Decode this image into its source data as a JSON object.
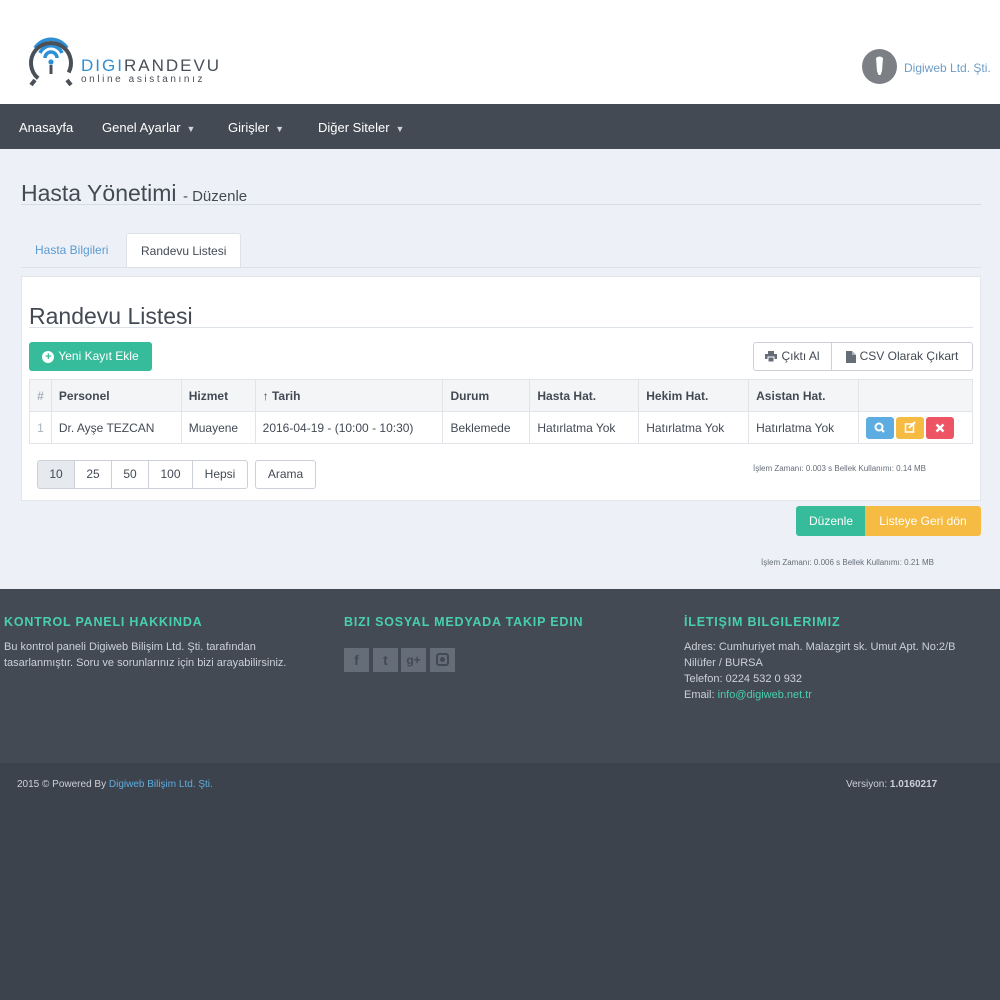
{
  "header": {
    "logo_text_accent": "DIGI",
    "logo_text_rest": "RANDEVU",
    "logo_subtitle": "online asistanınız",
    "user_name": "Digiweb Ltd. Şti."
  },
  "nav": {
    "items": [
      {
        "label": "Anasayfa"
      },
      {
        "label": "Genel Ayarlar"
      },
      {
        "label": "Girişler"
      },
      {
        "label": "Diğer Siteler"
      }
    ]
  },
  "page": {
    "title": "Hasta Yönetimi",
    "subtitle": "- Düzenle",
    "tabs": [
      {
        "label": "Hasta Bilgileri"
      },
      {
        "label": "Randevu Listesi"
      }
    ]
  },
  "panel": {
    "title": "Randevu Listesi",
    "add_button": "Yeni Kayıt Ekle",
    "print_button": "Çıktı Al",
    "csv_button": "CSV Olarak Çıkart",
    "columns": [
      "#",
      "Personel",
      "Hizmet",
      "↑ Tarih",
      "Durum",
      "Hasta Hat.",
      "Hekim Hat.",
      "Asistan Hat."
    ],
    "rows": [
      {
        "num": "1",
        "personel": "Dr. Ayşe TEZCAN",
        "hizmet": "Muayene",
        "tarih": "2016-04-19 - (10:00 - 10:30)",
        "durum": "Beklemede",
        "hasta_hat": "Hatırlatma Yok",
        "hekim_hat": "Hatırlatma Yok",
        "asistan_hat": "Hatırlatma Yok"
      }
    ],
    "page_sizes": [
      "10",
      "25",
      "50",
      "100",
      "Hepsi"
    ],
    "search_button": "Arama",
    "perf": "İşlem Zamanı: 0.003 s   Bellek Kullanımı: 0.14 MB"
  },
  "actions": {
    "edit_button": "Düzenle",
    "back_button": "Listeye Geri dön",
    "perf": "İşlem Zamanı: 0.006 s   Bellek Kullanımı: 0.21 MB"
  },
  "footer": {
    "about_title": "KONTROL PANELI HAKKINDA",
    "about_text_1": "Bu kontrol paneli Digiweb Bilişim Ltd. Şti. tarafından",
    "about_text_2": "tasarlanmıştır. Soru ve sorunlarınız için bizi arayabilirsiniz.",
    "social_title": "BIZI SOSYAL MEDYADA TAKIP EDIN",
    "social_icons": [
      "facebook-icon",
      "twitter-icon",
      "google-plus-icon",
      "instagram-icon"
    ],
    "contact_title": "İLETIŞIM BILGILERIMIZ",
    "address_1": "Adres: Cumhuriyet mah. Malazgirt sk. Umut Apt. No:2/B",
    "address_2": "Nilüfer / BURSA",
    "phone": "Telefon: 0224 532 0 932",
    "email_label": "Email:",
    "email": "info@digiweb.net.tr",
    "copyright": "2015 © Powered By",
    "copyright_link": "Digiweb Bilişim Ltd. Şti.",
    "version_label": "Versiyon:",
    "version": "1.0160217"
  },
  "colors": {
    "accent_green": "#37bc9b",
    "accent_yellow": "#f6bb42",
    "accent_blue": "#5dade2",
    "accent_red": "#ed5565",
    "nav_bg": "#434a54"
  }
}
